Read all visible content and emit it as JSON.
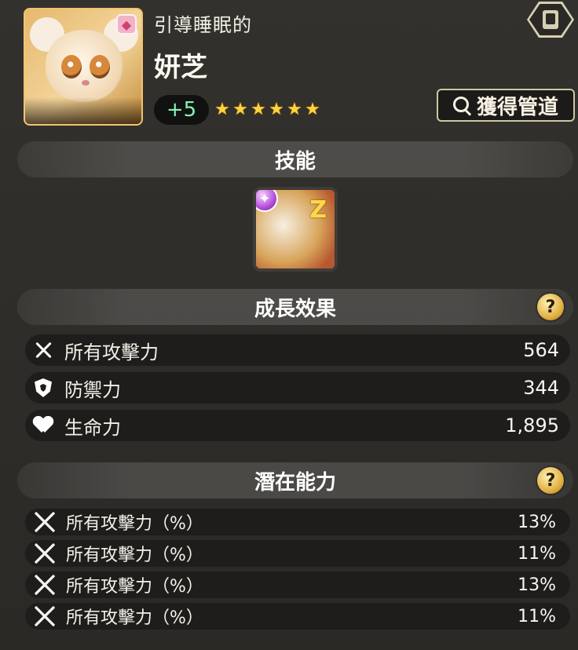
{
  "header": {
    "subtitle": "引導睡眠的",
    "name": "妍芝",
    "level": "+5",
    "stars_count": 6,
    "acquire_button_label": "獲得管道"
  },
  "sections": {
    "skills_title": "技能",
    "growth_title": "成長效果",
    "potential_title": "潛在能力",
    "help_icon_text": "?"
  },
  "growth": [
    {
      "icon": "sword-cross-icon",
      "label": "所有攻擊力",
      "value": "564"
    },
    {
      "icon": "shield-icon",
      "label": "防禦力",
      "value": "344"
    },
    {
      "icon": "heart-icon",
      "label": "生命力",
      "value": "1,895"
    }
  ],
  "potential": [
    {
      "icon": "sword-broken-icon",
      "label": "所有攻擊力（%）",
      "value": "13%"
    },
    {
      "icon": "sword-broken-icon",
      "label": "所有攻擊力（%）",
      "value": "11%"
    },
    {
      "icon": "sword-broken-icon",
      "label": "所有攻擊力（%）",
      "value": "13%"
    },
    {
      "icon": "sword-broken-icon",
      "label": "所有攻擊力（%）",
      "value": "11%"
    }
  ],
  "icons": {
    "book": "book-icon",
    "search": "search-icon",
    "skill_badge": "sparkle-icon",
    "character_badge": "rank-badge-icon"
  },
  "colors": {
    "background": "#2f2d2a",
    "row": "#1f1d1b",
    "accent_level": "#86f3b5",
    "star": "#ffd33f",
    "help_gold": "#e2b245"
  }
}
